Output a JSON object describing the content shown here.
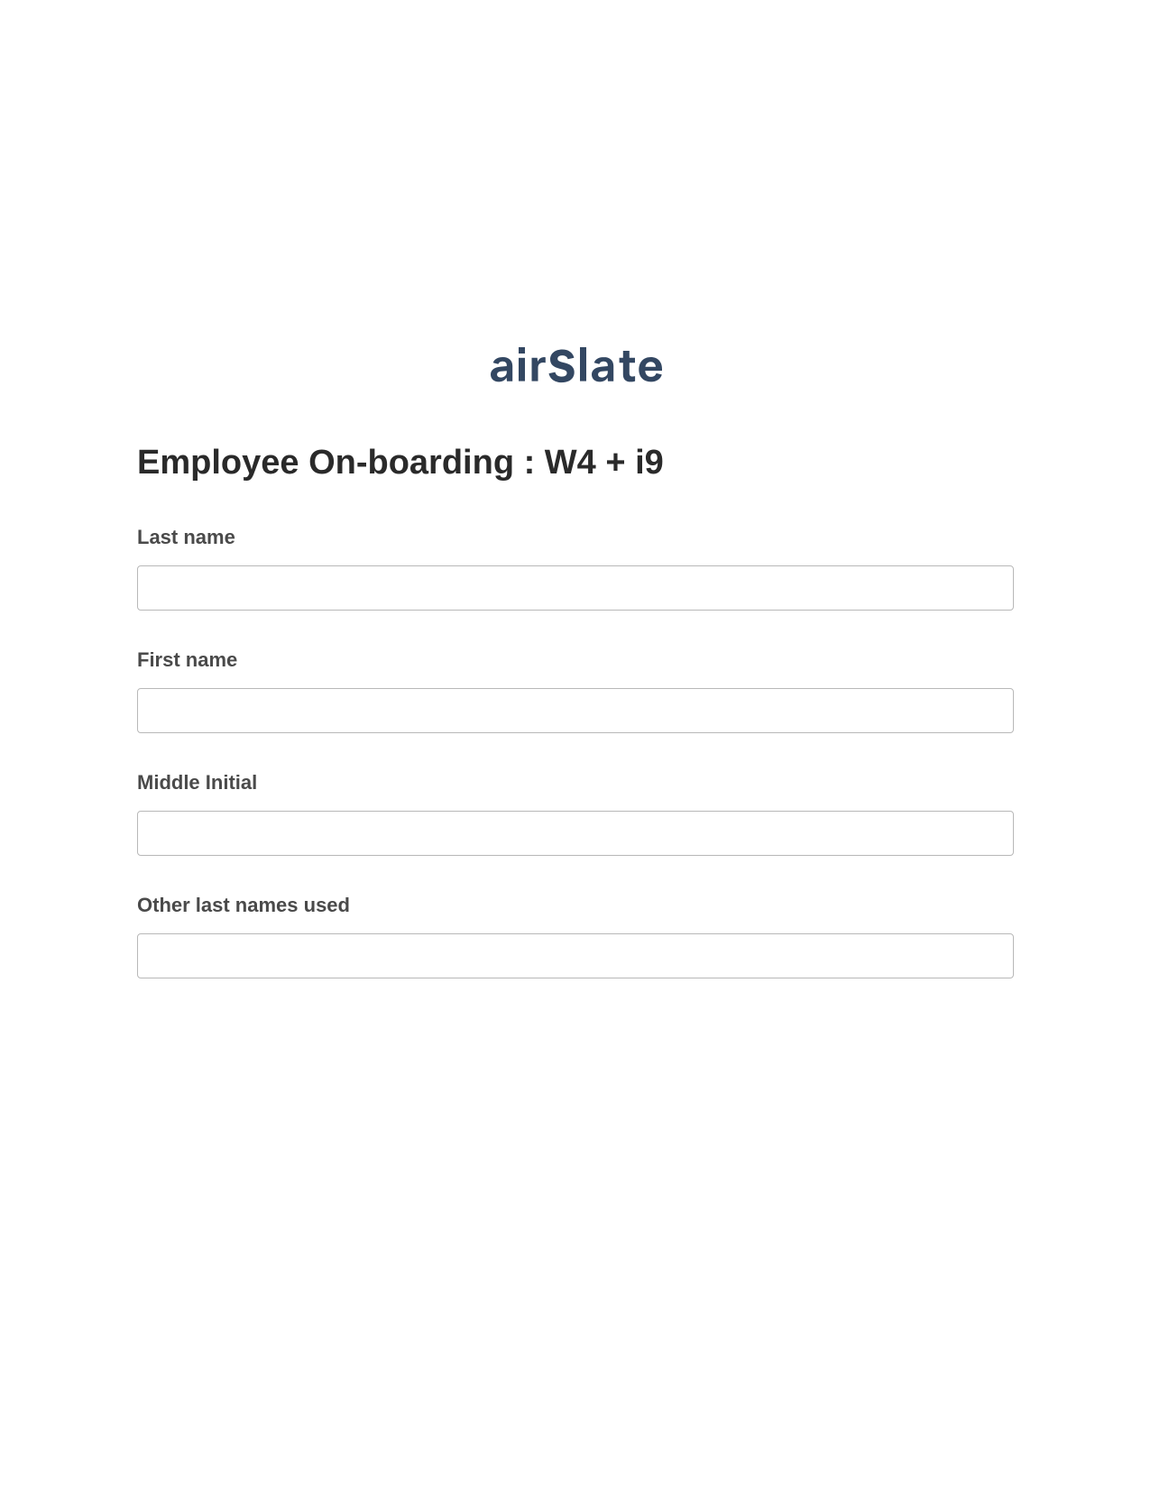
{
  "brand": {
    "name": "airSlate",
    "color": "#334762"
  },
  "form": {
    "title": "Employee On-boarding : W4 + i9",
    "fields": [
      {
        "label": "Last name",
        "value": ""
      },
      {
        "label": "First name",
        "value": ""
      },
      {
        "label": "Middle Initial",
        "value": ""
      },
      {
        "label": "Other last names used",
        "value": ""
      }
    ]
  }
}
